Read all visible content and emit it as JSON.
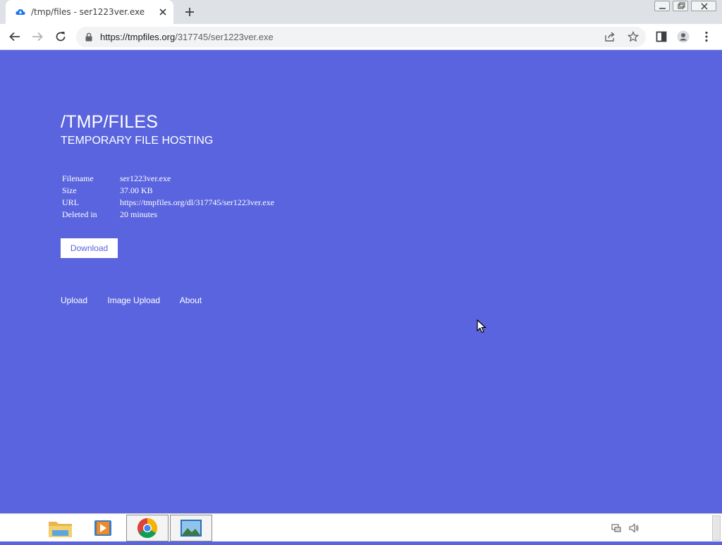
{
  "browser": {
    "tab_title": "/tmp/files - ser1223ver.exe",
    "url_host": "https://tmpfiles.org",
    "url_path": "/317745/ser1223ver.exe"
  },
  "site": {
    "title": "/TMP/FILES",
    "subtitle": "TEMPORARY FILE HOSTING"
  },
  "file_info": [
    {
      "label": "Filename",
      "value": "ser1223ver.exe"
    },
    {
      "label": "Size",
      "value": "37.00 KB"
    },
    {
      "label": "URL",
      "value": "https://tmpfiles.org/dl/317745/ser1223ver.exe"
    },
    {
      "label": "Deleted in",
      "value": "20 minutes"
    }
  ],
  "download_label": "Download",
  "footer": {
    "upload": "Upload",
    "image_upload": "Image Upload",
    "about": "About"
  },
  "colors": {
    "page_bg": "#5a64de",
    "text": "#ffffff",
    "button_text": "#5a64de"
  },
  "taskbar": {
    "apps": [
      "file-explorer-icon",
      "media-player-icon",
      "chrome-icon",
      "image-viewer-icon"
    ],
    "tray": [
      "network-icon",
      "volume-icon"
    ]
  }
}
